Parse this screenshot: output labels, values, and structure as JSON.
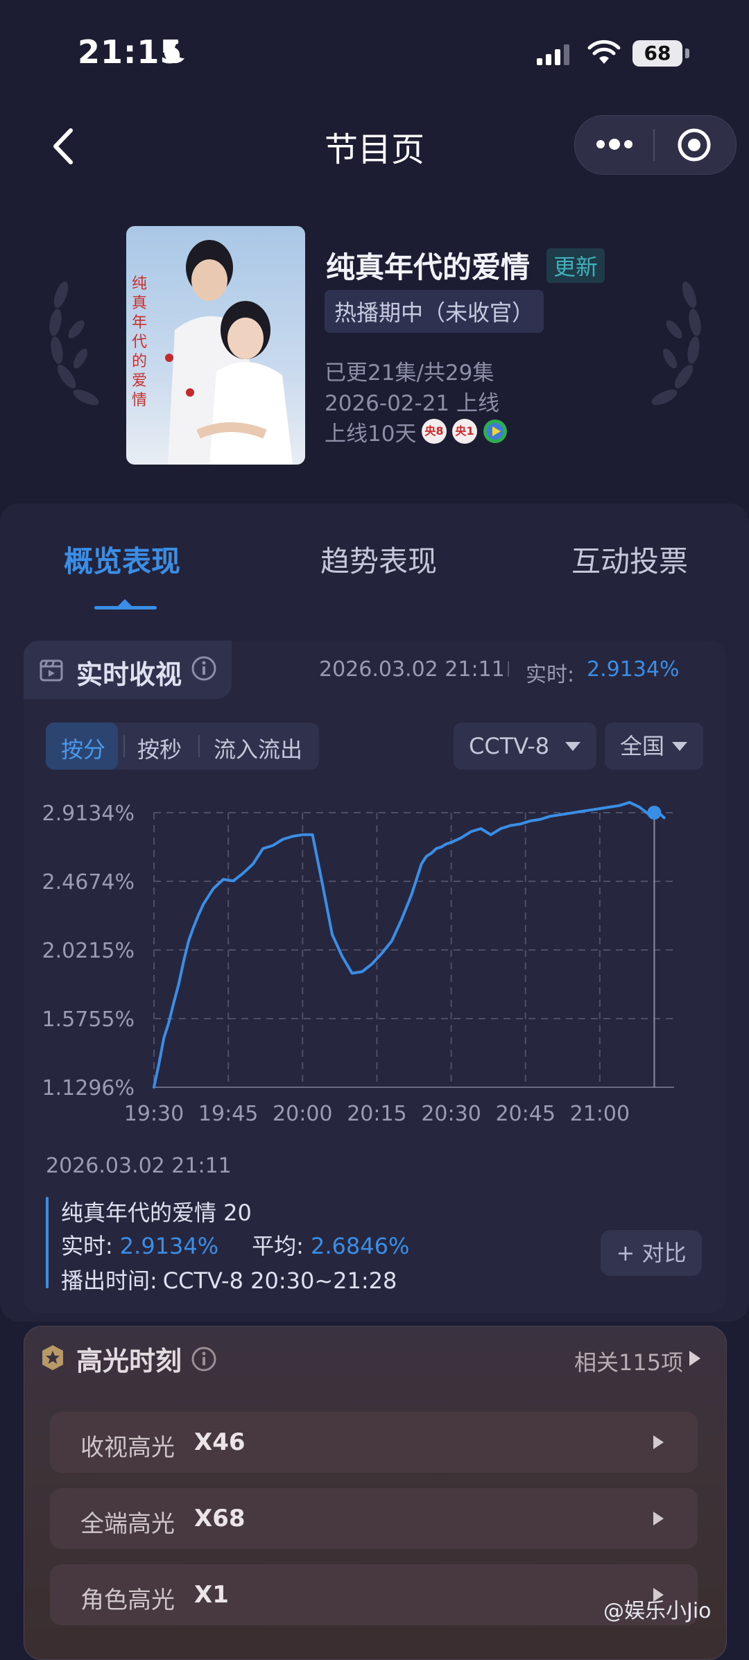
{
  "status_bar": {
    "time": "21:15",
    "battery": "68"
  },
  "nav": {
    "title": "节目页"
  },
  "program": {
    "title": "纯真年代的爱情",
    "badge": "更新",
    "status": "热播期中（未收官）",
    "episodes": "已更21集/共29集",
    "premiere": "2026-02-21 上线",
    "days_online": "上线10天",
    "channels": [
      "央8",
      "央1"
    ]
  },
  "tabs": [
    {
      "label": "概览表现",
      "active": true
    },
    {
      "label": "趋势表现",
      "active": false
    },
    {
      "label": "互动投票",
      "active": false
    }
  ],
  "realtime": {
    "title": "实时收视",
    "timestamp": "2026.03.02 21:11",
    "label": "实时:",
    "value": "2.9134%"
  },
  "controls": {
    "segments": [
      "按分",
      "按秒",
      "流入流出"
    ],
    "active_segment": "按分",
    "channel": "CCTV-8",
    "region": "全国"
  },
  "chart_data": {
    "type": "line",
    "x_ticks": [
      "19:30",
      "19:45",
      "20:00",
      "20:15",
      "20:30",
      "20:45",
      "21:00"
    ],
    "y_ticks": [
      "2.9134%",
      "2.4674%",
      "2.0215%",
      "1.5755%",
      "1.1296%"
    ],
    "ylim": [
      1.1296,
      2.9134
    ],
    "xlim_minutes": [
      0,
      105
    ],
    "grid": true,
    "marker_at": {
      "x": 101,
      "y": 2.9134
    },
    "series": [
      {
        "values_x_minutes": [
          0,
          1,
          2,
          3,
          4,
          5,
          6,
          7,
          8,
          9,
          10,
          12,
          14,
          16,
          18,
          20,
          22,
          24,
          26,
          28,
          30,
          32,
          34,
          36,
          38,
          40,
          42,
          44,
          46,
          48,
          50,
          52,
          54,
          55,
          56,
          57,
          58,
          59,
          60,
          62,
          64,
          66,
          68,
          70,
          72,
          74,
          76,
          78,
          80,
          82,
          84,
          86,
          88,
          90,
          92,
          94,
          96,
          98,
          100,
          101,
          102,
          103
        ],
        "values_y": [
          1.13,
          1.28,
          1.45,
          1.55,
          1.68,
          1.8,
          1.95,
          2.08,
          2.17,
          2.25,
          2.32,
          2.42,
          2.48,
          2.47,
          2.52,
          2.58,
          2.68,
          2.7,
          2.74,
          2.76,
          2.77,
          2.77,
          2.45,
          2.12,
          1.98,
          1.87,
          1.88,
          1.93,
          2.0,
          2.08,
          2.22,
          2.38,
          2.58,
          2.63,
          2.65,
          2.68,
          2.69,
          2.71,
          2.72,
          2.75,
          2.79,
          2.81,
          2.77,
          2.81,
          2.83,
          2.84,
          2.86,
          2.87,
          2.89,
          2.9,
          2.91,
          2.92,
          2.93,
          2.94,
          2.95,
          2.96,
          2.98,
          2.95,
          2.9,
          2.9134,
          2.91,
          2.88
        ]
      }
    ]
  },
  "detail": {
    "date": "2026.03.02 21:11",
    "episode": "纯真年代的爱情 20",
    "realtime_label": "实时:",
    "realtime_value": "2.9134%",
    "avg_label": "平均:",
    "avg_value": "2.6846%",
    "airtime_label": "播出时间:",
    "airtime": "CCTV-8 20:30~21:28",
    "compare_button": "+ 对比"
  },
  "highlights": {
    "title": "高光时刻",
    "related": "相关115项",
    "rows": [
      {
        "label": "收视高光",
        "value": "X46"
      },
      {
        "label": "全端高光",
        "value": "X68"
      },
      {
        "label": "角色高光",
        "value": "X1"
      }
    ]
  },
  "watermark": "@娱乐小Jio"
}
